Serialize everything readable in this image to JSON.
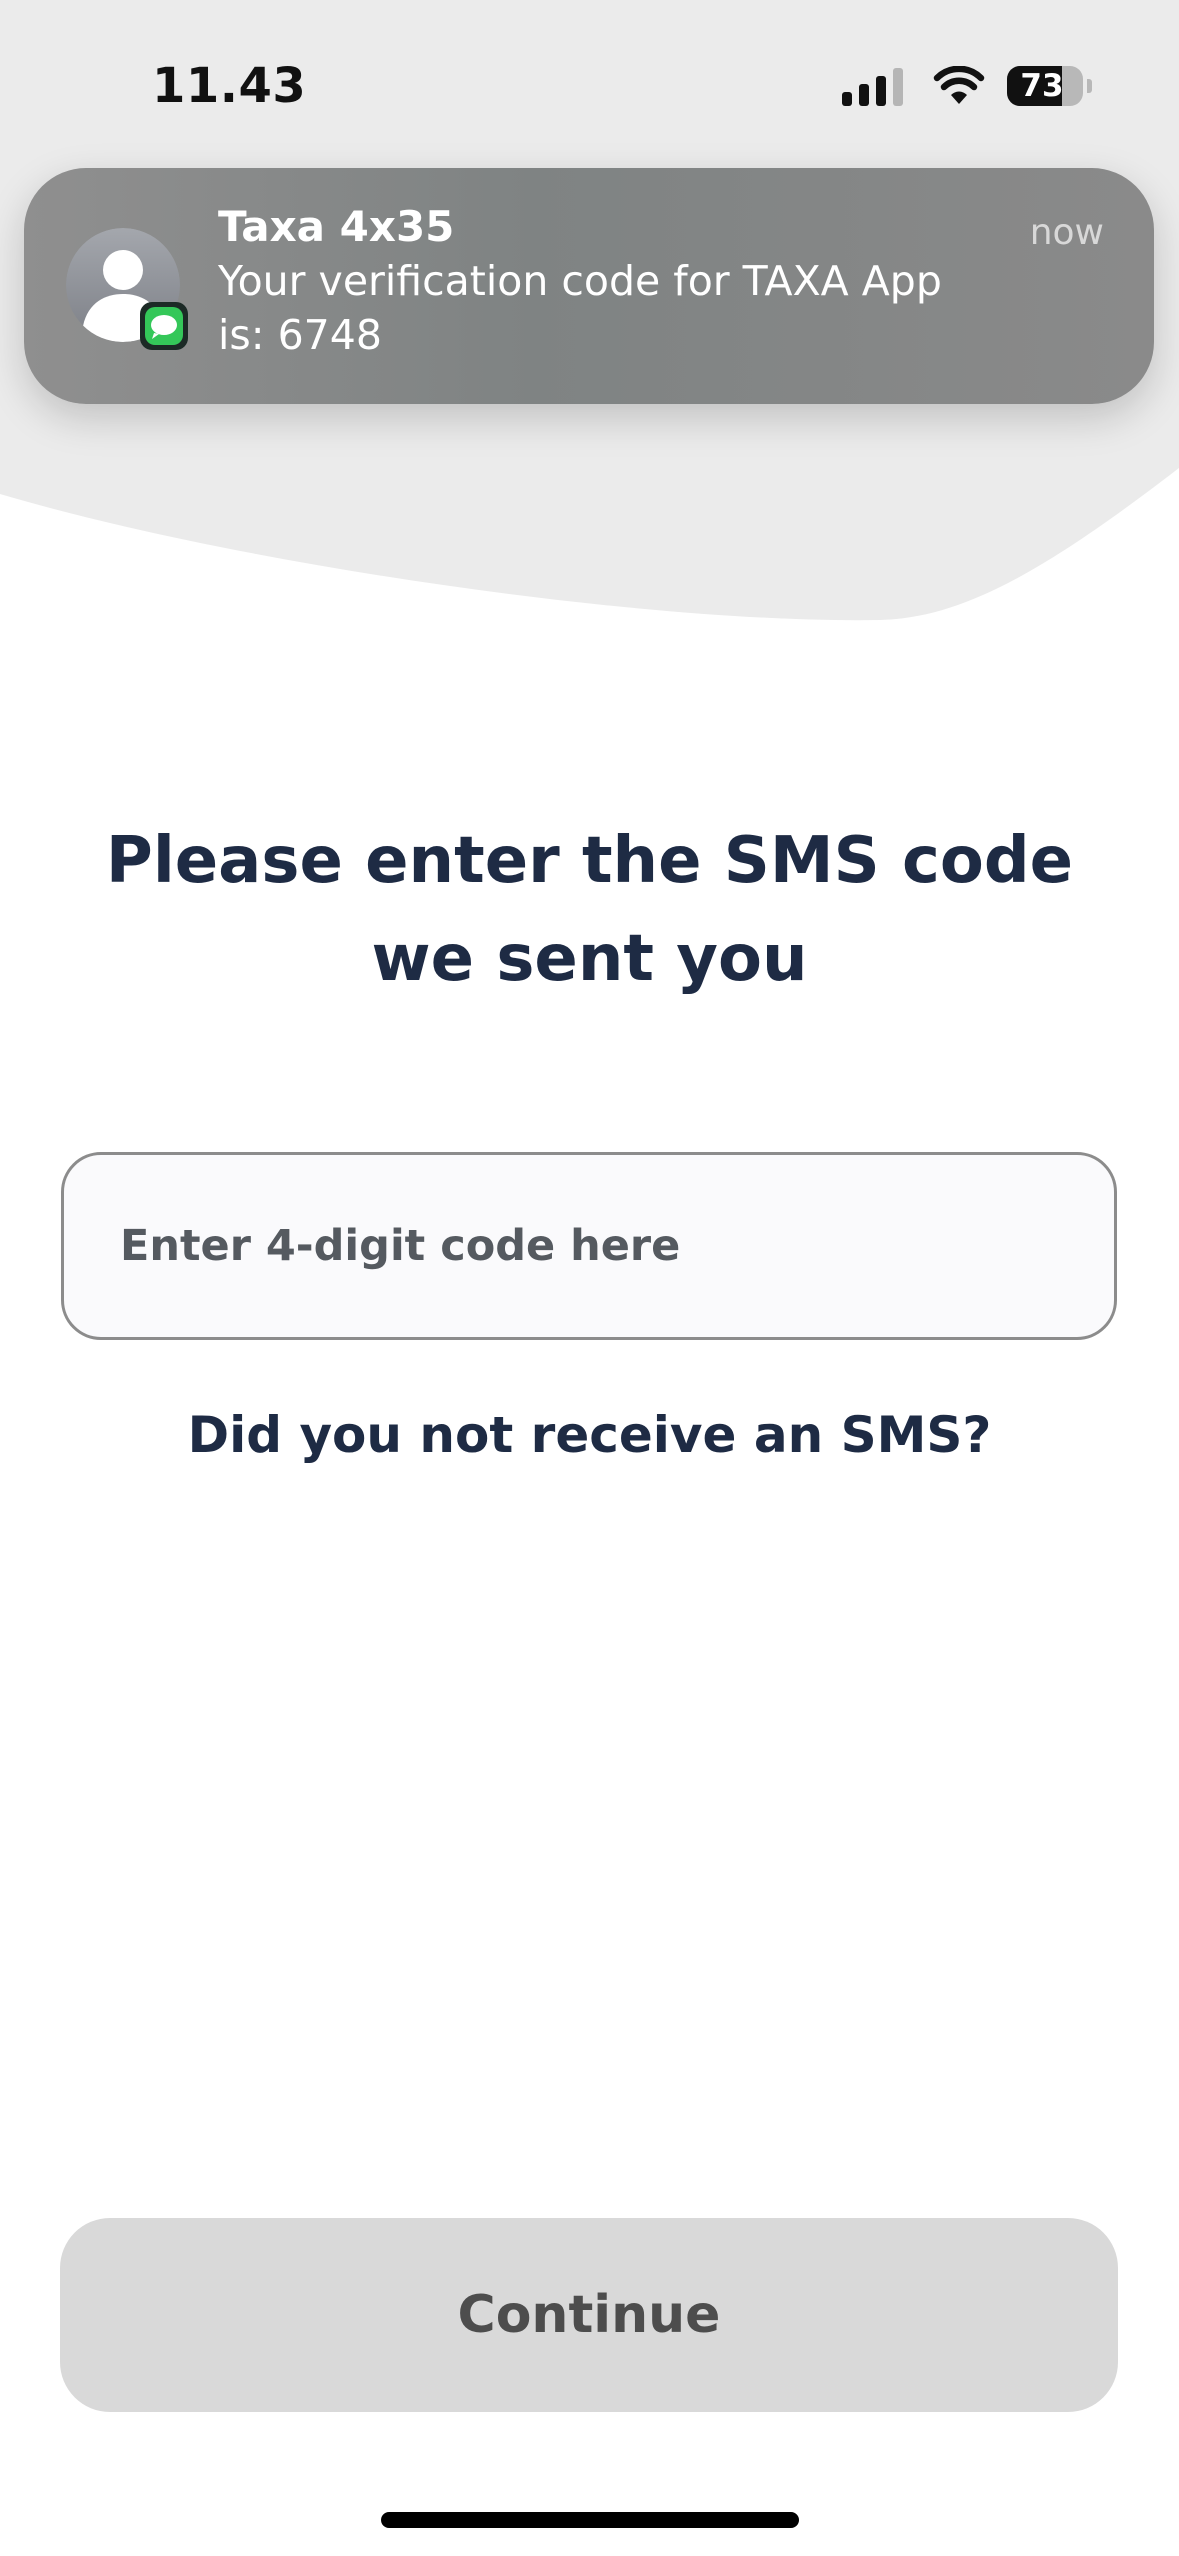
{
  "status_bar": {
    "time": "11.43",
    "battery_percent": 73,
    "battery_label": "73",
    "signal_bars_filled": 3,
    "signal_bars_total": 4
  },
  "notification": {
    "title": "Taxa 4x35",
    "body": "Your verification code for TAXA App\nis: 6748",
    "time": "now",
    "avatar_icon": "person-silhouette-icon",
    "app_icon": "messages-app-icon"
  },
  "main": {
    "heading": "Please enter the SMS code we sent you",
    "code_input": {
      "value": "",
      "placeholder": "Enter 4-digit code here"
    },
    "resend_link": "Did you not receive an SMS?",
    "continue_label": "Continue"
  },
  "colors": {
    "text_primary": "#1e2b44",
    "button_disabled_bg": "#d9d9d9",
    "top_background": "#ebebeb",
    "messages_green": "#34c759"
  }
}
